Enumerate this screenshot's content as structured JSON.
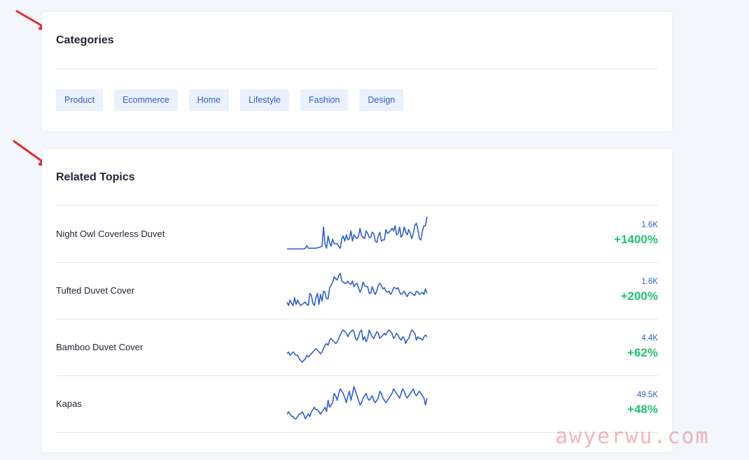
{
  "categories": {
    "title": "Categories",
    "tags": [
      "Product",
      "Ecommerce",
      "Home",
      "Lifestyle",
      "Fashion",
      "Design"
    ]
  },
  "related_topics": {
    "title": "Related Topics",
    "items": [
      {
        "name": "Night Owl Coverless Duvet",
        "volume": "1.6K",
        "growth": "+1400%",
        "trend": [
          0,
          0,
          0,
          0,
          0,
          0,
          0,
          0,
          0,
          0,
          0,
          0,
          1,
          5,
          1,
          1,
          1,
          1,
          1,
          1,
          2,
          2,
          3,
          4,
          34,
          8,
          1,
          20,
          10,
          4,
          15,
          8,
          8,
          8,
          4,
          1,
          16,
          20,
          12,
          22,
          14,
          16,
          28,
          12,
          22,
          18,
          16,
          20,
          32,
          20,
          18,
          16,
          28,
          24,
          18,
          18,
          26,
          24,
          12,
          10,
          20,
          26,
          12,
          14,
          14,
          30,
          24,
          26,
          28,
          32,
          28,
          36,
          22,
          24,
          34,
          18,
          22,
          34,
          26,
          22,
          30,
          24,
          16,
          24,
          36,
          40,
          30,
          16,
          14,
          28,
          36,
          36,
          50
        ]
      },
      {
        "name": "Tufted Duvet Cover",
        "volume": "1.6K",
        "growth": "+200%",
        "trend": [
          10,
          4,
          14,
          8,
          4,
          18,
          6,
          14,
          8,
          4,
          6,
          8,
          10,
          6,
          4,
          26,
          22,
          8,
          4,
          18,
          26,
          6,
          24,
          12,
          30,
          28,
          16,
          16,
          36,
          40,
          46,
          56,
          52,
          50,
          58,
          62,
          48,
          46,
          44,
          44,
          48,
          44,
          42,
          48,
          38,
          42,
          44,
          36,
          28,
          34,
          46,
          40,
          38,
          38,
          26,
          26,
          38,
          30,
          24,
          30,
          40,
          44,
          40,
          34,
          36,
          30,
          28,
          30,
          24,
          28,
          36,
          36,
          34,
          36,
          28,
          24,
          26,
          30,
          24,
          20,
          26,
          28,
          26,
          24,
          22,
          30,
          28,
          24,
          26,
          28,
          24,
          34,
          26
        ]
      },
      {
        "name": "Bamboo Duvet Cover",
        "volume": "4.4K",
        "growth": "+62%",
        "trend": [
          12,
          14,
          10,
          12,
          14,
          12,
          10,
          10,
          6,
          4,
          2,
          4,
          6,
          10,
          8,
          10,
          12,
          14,
          16,
          18,
          16,
          14,
          12,
          14,
          18,
          22,
          24,
          22,
          28,
          30,
          28,
          26,
          24,
          26,
          30,
          34,
          38,
          40,
          38,
          36,
          32,
          36,
          38,
          40,
          38,
          30,
          28,
          32,
          38,
          40,
          28,
          32,
          26,
          30,
          40,
          36,
          32,
          30,
          34,
          38,
          36,
          30,
          32,
          34,
          36,
          34,
          38,
          40,
          38,
          36,
          30,
          32,
          36,
          34,
          30,
          28,
          32,
          30,
          24,
          28,
          30,
          36,
          40,
          38,
          36,
          28,
          32,
          30,
          30,
          28,
          32,
          34,
          32
        ]
      },
      {
        "name": "Kapas",
        "volume": "49.5K",
        "growth": "+48%",
        "trend": [
          12,
          14,
          12,
          10,
          10,
          8,
          8,
          10,
          12,
          12,
          14,
          12,
          8,
          10,
          12,
          10,
          14,
          16,
          18,
          16,
          16,
          14,
          12,
          14,
          16,
          18,
          14,
          24,
          18,
          20,
          22,
          30,
          28,
          24,
          30,
          34,
          32,
          30,
          26,
          22,
          28,
          32,
          24,
          30,
          36,
          32,
          28,
          24,
          20,
          22,
          26,
          28,
          30,
          26,
          24,
          26,
          28,
          24,
          22,
          24,
          26,
          32,
          30,
          26,
          24,
          22,
          24,
          26,
          28,
          30,
          34,
          32,
          30,
          28,
          26,
          30,
          34,
          32,
          28,
          26,
          28,
          30,
          32,
          34,
          30,
          28,
          30,
          32,
          30,
          28,
          26,
          20,
          26
        ]
      }
    ]
  },
  "colors": {
    "accent": "#2f5fd1",
    "growth_green": "#22c372",
    "tag_bg": "#eaf1fd",
    "arrow_red": "#e62b2b"
  },
  "watermark": "awyerwu.com"
}
